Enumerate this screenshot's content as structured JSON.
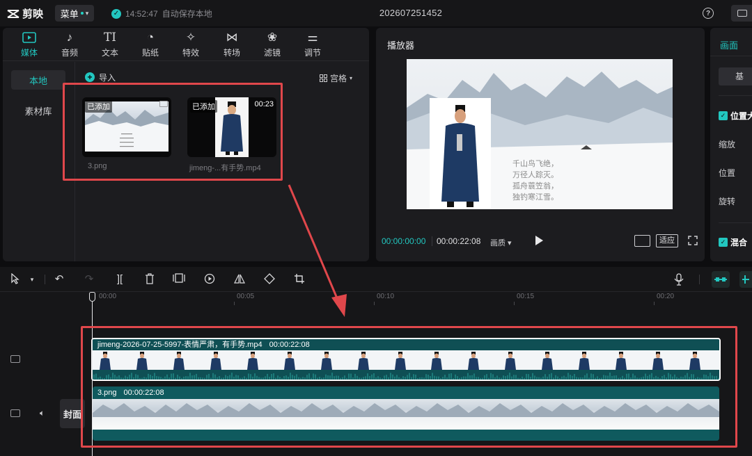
{
  "app": {
    "name": "剪映",
    "menu_label": "菜单",
    "project_title": "202607251452"
  },
  "save_status": {
    "time": "14:52:47",
    "text": "自动保存本地"
  },
  "media_tabs": [
    {
      "label": "媒体",
      "icon": "media-icon",
      "active": true
    },
    {
      "label": "音频",
      "icon": "audio-icon"
    },
    {
      "label": "文本",
      "icon": "text-icon"
    },
    {
      "label": "贴纸",
      "icon": "sticker-icon"
    },
    {
      "label": "特效",
      "icon": "effects-icon"
    },
    {
      "label": "转场",
      "icon": "transition-icon"
    },
    {
      "label": "滤镜",
      "icon": "filter-icon"
    },
    {
      "label": "调节",
      "icon": "adjust-icon"
    }
  ],
  "media_side": {
    "local": "本地",
    "library": "素材库"
  },
  "media_toolbar": {
    "import": "导入",
    "view": "宫格"
  },
  "media_items": [
    {
      "badge": "已添加",
      "name": "3.png",
      "duration": ""
    },
    {
      "badge": "已添加",
      "name": "jimeng-...有手势.mp4",
      "duration": "00:23"
    }
  ],
  "player": {
    "title": "播放器",
    "current_time": "00:00:00:00",
    "total_time": "00:00:22:08",
    "quality": "画质",
    "fit": "适应",
    "poem_lines": [
      "千山鸟飞绝，",
      "万径人踪灭。",
      "孤舟蓑笠翁，",
      "独钓寒江雪。"
    ]
  },
  "props": {
    "tab": "画面",
    "basic": "基",
    "position_size": "位置大",
    "scale": "缩放",
    "position": "位置",
    "rotate": "旋转",
    "blend": "混合"
  },
  "timeline": {
    "ruler_labels": [
      "00:00",
      "00:05",
      "00:10",
      "00:15",
      "00:20"
    ],
    "cover_label": "封面",
    "tracks": [
      {
        "clip_name": "jimeng-2026-07-25-5997-表情严肃，有手势.mp4",
        "clip_duration": "00:00:22:08"
      },
      {
        "clip_name": "3.png",
        "clip_duration": "00:00:22:08"
      }
    ]
  },
  "colors": {
    "accent": "#22c7c0",
    "highlight": "#e0474b",
    "clip": "#0f4f54"
  }
}
